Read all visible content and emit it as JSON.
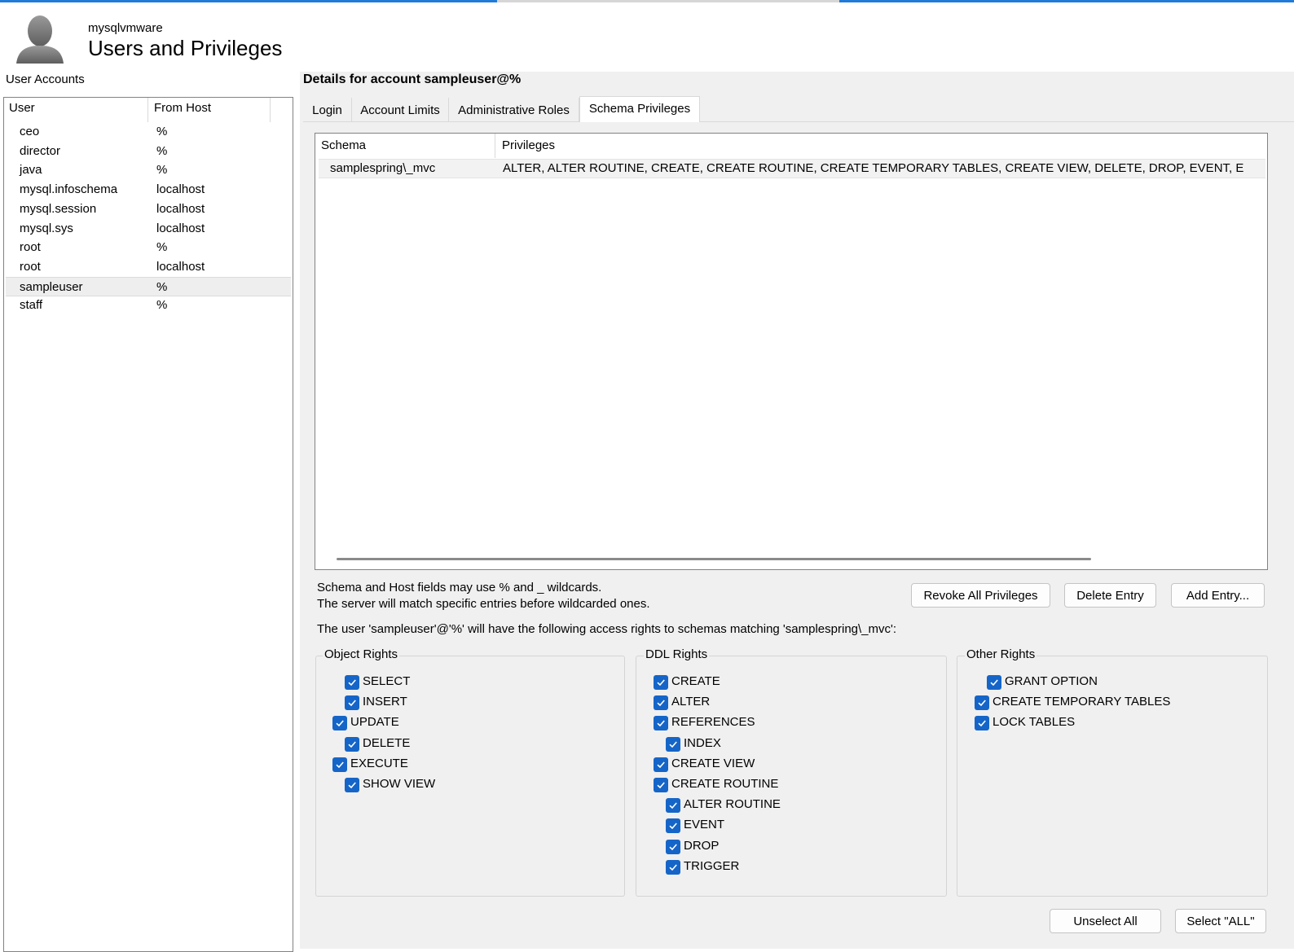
{
  "header": {
    "connection": "mysqlvmware",
    "title": "Users and Privileges"
  },
  "user_accounts": {
    "label": "User Accounts",
    "columns": [
      "User",
      "From Host"
    ],
    "rows": [
      {
        "user": "ceo",
        "host": "%"
      },
      {
        "user": "director",
        "host": "%"
      },
      {
        "user": "java",
        "host": "%"
      },
      {
        "user": "mysql.infoschema",
        "host": "localhost"
      },
      {
        "user": "mysql.session",
        "host": "localhost"
      },
      {
        "user": "mysql.sys",
        "host": "localhost"
      },
      {
        "user": "root",
        "host": "%"
      },
      {
        "user": "root",
        "host": "localhost"
      },
      {
        "user": "sampleuser",
        "host": "%"
      },
      {
        "user": "staff",
        "host": "%"
      }
    ],
    "selected_index": 8
  },
  "details": {
    "title": "Details for account sampleuser@%",
    "tabs": [
      "Login",
      "Account Limits",
      "Administrative Roles",
      "Schema Privileges"
    ],
    "active_tab": "Schema Privileges"
  },
  "schema_grid": {
    "columns": [
      "Schema",
      "Privileges"
    ],
    "rows": [
      {
        "schema": "samplespring\\_mvc",
        "privileges": "ALTER, ALTER ROUTINE, CREATE, CREATE ROUTINE, CREATE TEMPORARY TABLES, CREATE VIEW, DELETE, DROP, EVENT, E"
      }
    ]
  },
  "hints": {
    "line1": "Schema and Host fields may use % and _ wildcards.",
    "line2": "The server will match specific entries before wildcarded ones.",
    "access": "The user 'sampleuser'@'%' will have the following access rights to schemas matching 'samplespring\\_mvc':"
  },
  "buttons": {
    "revoke_all": "Revoke All Privileges",
    "delete_entry": "Delete Entry",
    "add_entry": "Add Entry...",
    "unselect_all": "Unselect All",
    "select_all": "Select \"ALL\""
  },
  "groups": {
    "object_rights": {
      "title": "Object Rights",
      "items": [
        {
          "label": "SELECT",
          "checked": true,
          "indent": 1
        },
        {
          "label": "INSERT",
          "checked": true,
          "indent": 1
        },
        {
          "label": "UPDATE",
          "checked": true,
          "indent": 0
        },
        {
          "label": "DELETE",
          "checked": true,
          "indent": 1
        },
        {
          "label": "EXECUTE",
          "checked": true,
          "indent": 0
        },
        {
          "label": "SHOW VIEW",
          "checked": true,
          "indent": 1
        }
      ]
    },
    "ddl_rights": {
      "title": "DDL Rights",
      "items": [
        {
          "label": "CREATE",
          "checked": true,
          "indent": 0
        },
        {
          "label": "ALTER",
          "checked": true,
          "indent": 0
        },
        {
          "label": "REFERENCES",
          "checked": true,
          "indent": 0
        },
        {
          "label": "INDEX",
          "checked": true,
          "indent": 1
        },
        {
          "label": "CREATE VIEW",
          "checked": true,
          "indent": 0
        },
        {
          "label": "CREATE ROUTINE",
          "checked": true,
          "indent": 0
        },
        {
          "label": "ALTER ROUTINE",
          "checked": true,
          "indent": 1
        },
        {
          "label": "EVENT",
          "checked": true,
          "indent": 1
        },
        {
          "label": "DROP",
          "checked": true,
          "indent": 1
        },
        {
          "label": "TRIGGER",
          "checked": true,
          "indent": 1
        }
      ]
    },
    "other_rights": {
      "title": "Other Rights",
      "items": [
        {
          "label": "GRANT OPTION",
          "checked": true,
          "indent": 1
        },
        {
          "label": "CREATE TEMPORARY TABLES",
          "checked": true,
          "indent": 0
        },
        {
          "label": "LOCK TABLES",
          "checked": true,
          "indent": 0
        }
      ]
    }
  },
  "colors": {
    "accent": "#1f7ad8",
    "checkbox": "#1565c8",
    "panel_bg": "#f0f0f0"
  }
}
